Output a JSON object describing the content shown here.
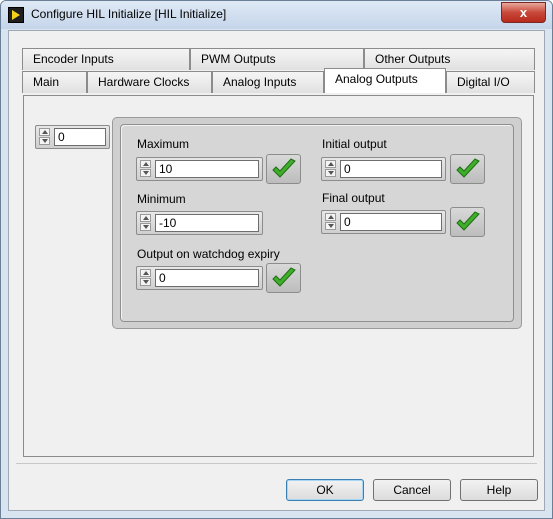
{
  "window": {
    "title": "Configure HIL Initialize [HIL Initialize]",
    "close_label": "x"
  },
  "tabs": {
    "row_back": [
      {
        "label": "Encoder Inputs"
      },
      {
        "label": "PWM Outputs"
      },
      {
        "label": "Other Outputs"
      }
    ],
    "row_front": [
      {
        "label": "Main"
      },
      {
        "label": "Hardware Clocks"
      },
      {
        "label": "Analog Inputs"
      },
      {
        "label": "Analog Outputs"
      },
      {
        "label": "Digital I/O"
      }
    ],
    "active": "Analog Outputs"
  },
  "channel_index": {
    "value": "0"
  },
  "cluster": {
    "maximum": {
      "label": "Maximum",
      "value": "10"
    },
    "minimum": {
      "label": "Minimum",
      "value": "-10"
    },
    "watchdog": {
      "label": "Output on watchdog expiry",
      "value": "0"
    },
    "initial_output": {
      "label": "Initial output",
      "value": "0"
    },
    "final_output": {
      "label": "Final output",
      "value": "0"
    }
  },
  "buttons": {
    "ok": "OK",
    "cancel": "Cancel",
    "help": "Help"
  },
  "colors": {
    "check_green": "#3fae2a",
    "tab_active": "#ffffff",
    "default_button_border": "#3c7fb1"
  }
}
